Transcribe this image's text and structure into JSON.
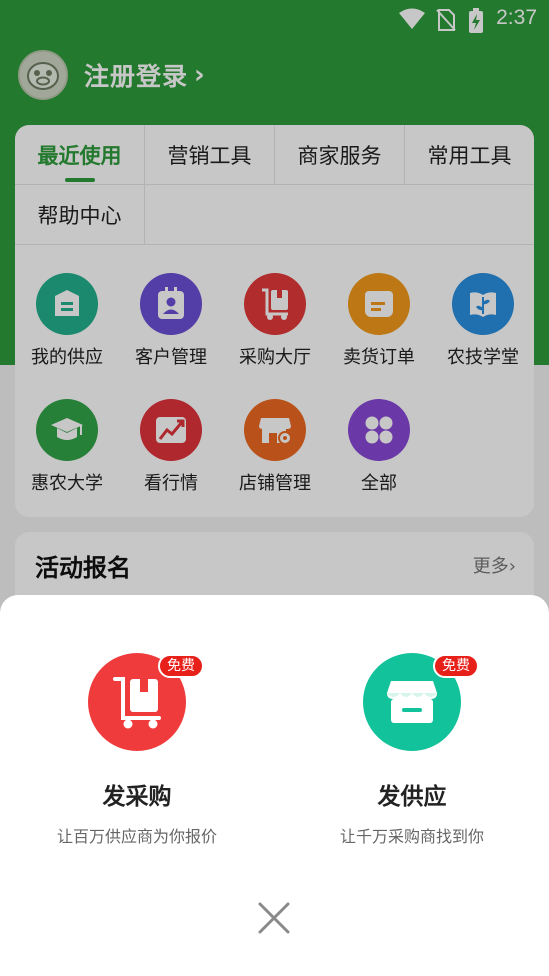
{
  "status_bar": {
    "time": "2:37",
    "icons": [
      "wifi-icon",
      "no-sim-icon",
      "battery-charging-icon"
    ]
  },
  "header": {
    "login_label": "注册登录",
    "arrow": "›"
  },
  "tabs": [
    {
      "label": "最近使用",
      "active": true
    },
    {
      "label": "营销工具"
    },
    {
      "label": "商家服务"
    },
    {
      "label": "常用工具"
    },
    {
      "label": "帮助中心"
    }
  ],
  "tools": [
    {
      "label": "我的供应",
      "icon": "supply-box-icon",
      "color": "#23b08e"
    },
    {
      "label": "客户管理",
      "icon": "contact-card-icon",
      "color": "#6b4fd6"
    },
    {
      "label": "采购大厅",
      "icon": "cart-icon",
      "color": "#e33a3a"
    },
    {
      "label": "卖货订单",
      "icon": "order-icon",
      "color": "#f39a1b"
    },
    {
      "label": "农技学堂",
      "icon": "leaf-book-icon",
      "color": "#2a8fe0"
    },
    {
      "label": "惠农大学",
      "icon": "graduation-cap-icon",
      "color": "#32a447"
    },
    {
      "label": "看行情",
      "icon": "trend-chart-icon",
      "color": "#e0343c"
    },
    {
      "label": "店铺管理",
      "icon": "shop-gear-icon",
      "color": "#ee6a22"
    },
    {
      "label": "全部",
      "icon": "grid-all-icon",
      "color": "#8a49d6"
    }
  ],
  "activity": {
    "title": "活动报名",
    "more": "更多›"
  },
  "sheet": {
    "options": [
      {
        "name": "发采购",
        "desc": "让百万供应商为你报价",
        "badge": "免费",
        "icon": "purchase-cart-icon",
        "color": "#ef3b3b"
      },
      {
        "name": "发供应",
        "desc": "让千万采购商找到你",
        "badge": "免费",
        "icon": "supply-store-icon",
        "color": "#12c29a"
      }
    ]
  }
}
